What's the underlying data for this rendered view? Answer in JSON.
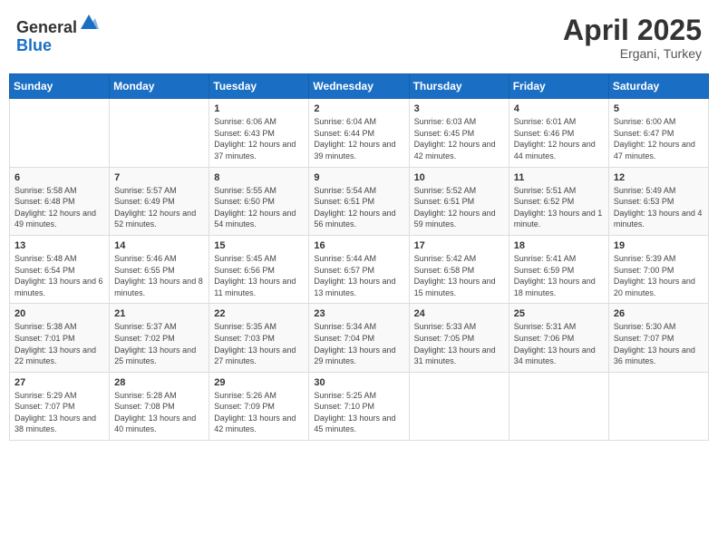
{
  "header": {
    "logo_line1": "General",
    "logo_line2": "Blue",
    "month": "April 2025",
    "location": "Ergani, Turkey"
  },
  "weekdays": [
    "Sunday",
    "Monday",
    "Tuesday",
    "Wednesday",
    "Thursday",
    "Friday",
    "Saturday"
  ],
  "weeks": [
    [
      {
        "day": "",
        "info": ""
      },
      {
        "day": "",
        "info": ""
      },
      {
        "day": "1",
        "info": "Sunrise: 6:06 AM\nSunset: 6:43 PM\nDaylight: 12 hours and 37 minutes."
      },
      {
        "day": "2",
        "info": "Sunrise: 6:04 AM\nSunset: 6:44 PM\nDaylight: 12 hours and 39 minutes."
      },
      {
        "day": "3",
        "info": "Sunrise: 6:03 AM\nSunset: 6:45 PM\nDaylight: 12 hours and 42 minutes."
      },
      {
        "day": "4",
        "info": "Sunrise: 6:01 AM\nSunset: 6:46 PM\nDaylight: 12 hours and 44 minutes."
      },
      {
        "day": "5",
        "info": "Sunrise: 6:00 AM\nSunset: 6:47 PM\nDaylight: 12 hours and 47 minutes."
      }
    ],
    [
      {
        "day": "6",
        "info": "Sunrise: 5:58 AM\nSunset: 6:48 PM\nDaylight: 12 hours and 49 minutes."
      },
      {
        "day": "7",
        "info": "Sunrise: 5:57 AM\nSunset: 6:49 PM\nDaylight: 12 hours and 52 minutes."
      },
      {
        "day": "8",
        "info": "Sunrise: 5:55 AM\nSunset: 6:50 PM\nDaylight: 12 hours and 54 minutes."
      },
      {
        "day": "9",
        "info": "Sunrise: 5:54 AM\nSunset: 6:51 PM\nDaylight: 12 hours and 56 minutes."
      },
      {
        "day": "10",
        "info": "Sunrise: 5:52 AM\nSunset: 6:51 PM\nDaylight: 12 hours and 59 minutes."
      },
      {
        "day": "11",
        "info": "Sunrise: 5:51 AM\nSunset: 6:52 PM\nDaylight: 13 hours and 1 minute."
      },
      {
        "day": "12",
        "info": "Sunrise: 5:49 AM\nSunset: 6:53 PM\nDaylight: 13 hours and 4 minutes."
      }
    ],
    [
      {
        "day": "13",
        "info": "Sunrise: 5:48 AM\nSunset: 6:54 PM\nDaylight: 13 hours and 6 minutes."
      },
      {
        "day": "14",
        "info": "Sunrise: 5:46 AM\nSunset: 6:55 PM\nDaylight: 13 hours and 8 minutes."
      },
      {
        "day": "15",
        "info": "Sunrise: 5:45 AM\nSunset: 6:56 PM\nDaylight: 13 hours and 11 minutes."
      },
      {
        "day": "16",
        "info": "Sunrise: 5:44 AM\nSunset: 6:57 PM\nDaylight: 13 hours and 13 minutes."
      },
      {
        "day": "17",
        "info": "Sunrise: 5:42 AM\nSunset: 6:58 PM\nDaylight: 13 hours and 15 minutes."
      },
      {
        "day": "18",
        "info": "Sunrise: 5:41 AM\nSunset: 6:59 PM\nDaylight: 13 hours and 18 minutes."
      },
      {
        "day": "19",
        "info": "Sunrise: 5:39 AM\nSunset: 7:00 PM\nDaylight: 13 hours and 20 minutes."
      }
    ],
    [
      {
        "day": "20",
        "info": "Sunrise: 5:38 AM\nSunset: 7:01 PM\nDaylight: 13 hours and 22 minutes."
      },
      {
        "day": "21",
        "info": "Sunrise: 5:37 AM\nSunset: 7:02 PM\nDaylight: 13 hours and 25 minutes."
      },
      {
        "day": "22",
        "info": "Sunrise: 5:35 AM\nSunset: 7:03 PM\nDaylight: 13 hours and 27 minutes."
      },
      {
        "day": "23",
        "info": "Sunrise: 5:34 AM\nSunset: 7:04 PM\nDaylight: 13 hours and 29 minutes."
      },
      {
        "day": "24",
        "info": "Sunrise: 5:33 AM\nSunset: 7:05 PM\nDaylight: 13 hours and 31 minutes."
      },
      {
        "day": "25",
        "info": "Sunrise: 5:31 AM\nSunset: 7:06 PM\nDaylight: 13 hours and 34 minutes."
      },
      {
        "day": "26",
        "info": "Sunrise: 5:30 AM\nSunset: 7:07 PM\nDaylight: 13 hours and 36 minutes."
      }
    ],
    [
      {
        "day": "27",
        "info": "Sunrise: 5:29 AM\nSunset: 7:07 PM\nDaylight: 13 hours and 38 minutes."
      },
      {
        "day": "28",
        "info": "Sunrise: 5:28 AM\nSunset: 7:08 PM\nDaylight: 13 hours and 40 minutes."
      },
      {
        "day": "29",
        "info": "Sunrise: 5:26 AM\nSunset: 7:09 PM\nDaylight: 13 hours and 42 minutes."
      },
      {
        "day": "30",
        "info": "Sunrise: 5:25 AM\nSunset: 7:10 PM\nDaylight: 13 hours and 45 minutes."
      },
      {
        "day": "",
        "info": ""
      },
      {
        "day": "",
        "info": ""
      },
      {
        "day": "",
        "info": ""
      }
    ]
  ]
}
